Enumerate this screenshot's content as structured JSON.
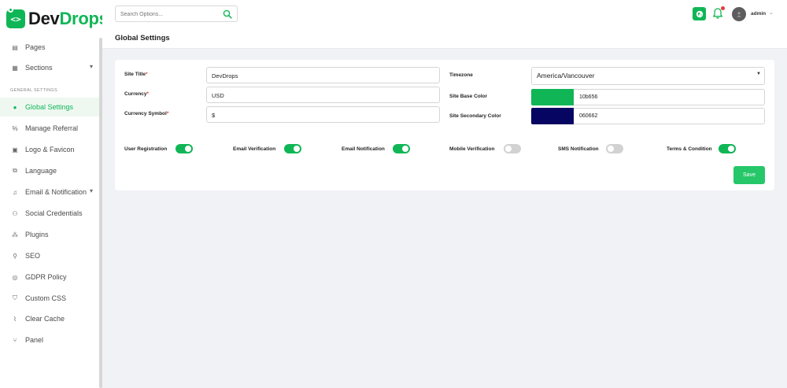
{
  "brand": {
    "name_part1": "Dev",
    "name_part2": "Drops",
    "mark": "<>"
  },
  "sidebar": {
    "items_top": [
      {
        "label": "Pages",
        "icon": "pages-icon"
      },
      {
        "label": "Sections",
        "icon": "sections-icon",
        "has_children": true
      }
    ],
    "heading": "GENERAL SETTINGS",
    "items": [
      {
        "label": "Global Settings",
        "icon": "globe-icon",
        "active": true
      },
      {
        "label": "Manage Referral",
        "icon": "percent-icon"
      },
      {
        "label": "Logo & Favicon",
        "icon": "image-icon"
      },
      {
        "label": "Language",
        "icon": "language-icon"
      },
      {
        "label": "Email & Notification",
        "icon": "bell-icon",
        "has_children": true
      },
      {
        "label": "Social Credentials",
        "icon": "social-icon"
      },
      {
        "label": "Plugins",
        "icon": "plugins-icon"
      },
      {
        "label": "SEO",
        "icon": "seo-icon"
      },
      {
        "label": "GDPR Policy",
        "icon": "gdpr-icon"
      },
      {
        "label": "Custom CSS",
        "icon": "css-icon"
      },
      {
        "label": "Clear Cache",
        "icon": "broom-icon"
      },
      {
        "label": "Panel",
        "icon": "branch-icon"
      }
    ]
  },
  "topbar": {
    "search_placeholder": "Search Options...",
    "page_title": "Global Settings",
    "user": {
      "name": "admin"
    }
  },
  "form": {
    "site_title": {
      "label": "Site Title",
      "value": "DevDrops",
      "required": "*"
    },
    "currency": {
      "label": "Currency",
      "value": "USD",
      "required": "*"
    },
    "currency_symbol": {
      "label": "Currency Symbol",
      "value": "$",
      "required": "*"
    },
    "timezone": {
      "label": "Timezone",
      "value": "America/Vancouver"
    },
    "site_base_color": {
      "label": "Site Base Color",
      "value": "10b656",
      "hex": "#10b656"
    },
    "site_secondary_color": {
      "label": "Site Secondary Color",
      "value": "060662",
      "hex": "#060662"
    },
    "toggles": [
      {
        "label": "User Registration",
        "on": true
      },
      {
        "label": "Email Verification",
        "on": true
      },
      {
        "label": "Email Notification",
        "on": true
      },
      {
        "label": "Mobile Verification",
        "on": false
      },
      {
        "label": "SMS Notification",
        "on": false
      },
      {
        "label": "Terms & Condition",
        "on": true
      }
    ],
    "save_label": "Save"
  },
  "colors": {
    "accent": "#10b656",
    "save_button": "#26c769",
    "notification_dot": "#e63a3a"
  }
}
